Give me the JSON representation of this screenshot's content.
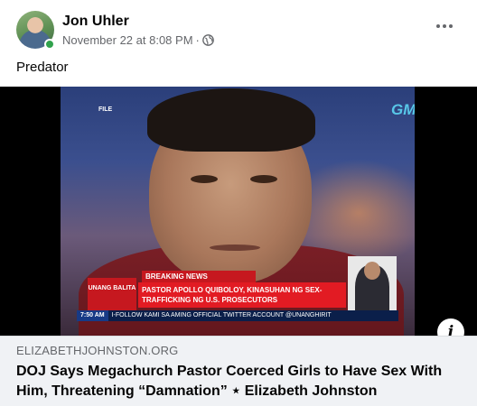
{
  "post": {
    "author": "Jon Uhler",
    "timestamp": "November 22 at 8:08 PM",
    "separator": "·",
    "text": "Predator",
    "privacy_icon": "globe-icon",
    "more_icon": "more-horizontal-icon"
  },
  "video": {
    "file_tag": "FILE",
    "logo_text": "GMA",
    "breaking_label": "BREAKING NEWS",
    "headline": "PASTOR APOLLO QUIBOLOY, KINASUHAN NG SEX-TRAFFICKING NG U.S. PROSECUTORS",
    "show_name": "UNANG BALITA",
    "ticker_time": "7:50 AM",
    "ticker_text": "I-FOLLOW KAMI SA AMING OFFICIAL TWITTER ACCOUNT @UNANGHIRIT"
  },
  "link": {
    "domain": "ELIZABETHJOHNSTON.ORG",
    "title": "DOJ Says Megachurch Pastor Coerced Girls to Have Sex With Him, Threatening “Damnation” ⋆ Elizabeth Johnston",
    "info_icon": "info-icon"
  },
  "colors": {
    "meta_text": "#65676b",
    "online": "#31a24c",
    "preview_bg": "#f0f2f5"
  }
}
